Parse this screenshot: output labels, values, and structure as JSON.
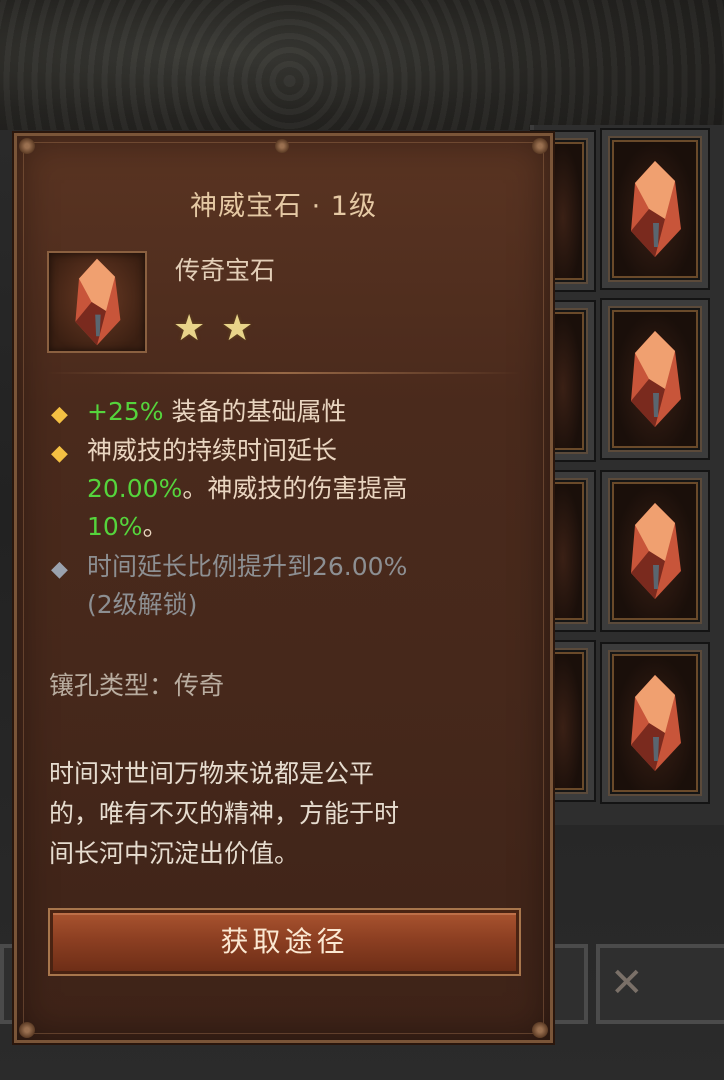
{
  "tooltip": {
    "title": "神威宝石 · 1级",
    "gem_type": "传奇宝石",
    "stars": [
      "★",
      "★"
    ],
    "star_rating": 2,
    "effects": [
      {
        "icon": "gold-diamond-icon",
        "parts": [
          "+25%",
          " 装备的基础属性"
        ]
      },
      {
        "icon": "gold-diamond-icon",
        "lines": [
          "神威技的持续时间延长",
          "20.00%",
          "。神威技的伤害提高",
          "10%",
          "。"
        ]
      },
      {
        "icon": "grey-diamond-icon",
        "lines": [
          "时间延长比例提升到26.00%",
          "(2级解锁)"
        ]
      }
    ],
    "socket_label": "镶孔类型：",
    "socket_value": "传奇",
    "lore": [
      "时间对世间万物来说都是公平",
      "的，唯有不灭的精神，方能于时",
      "间长河中沉淀出价值。"
    ],
    "acquire_button": "获取途径"
  },
  "colors": {
    "panel_bg": "#4a2a1c",
    "green_value": "#55d43c",
    "gold_bullet": "#f4c043",
    "title_text": "#e5c9a4"
  },
  "inventory": {
    "slot_count": 4,
    "item_icon": "legendary-gem-icon"
  }
}
